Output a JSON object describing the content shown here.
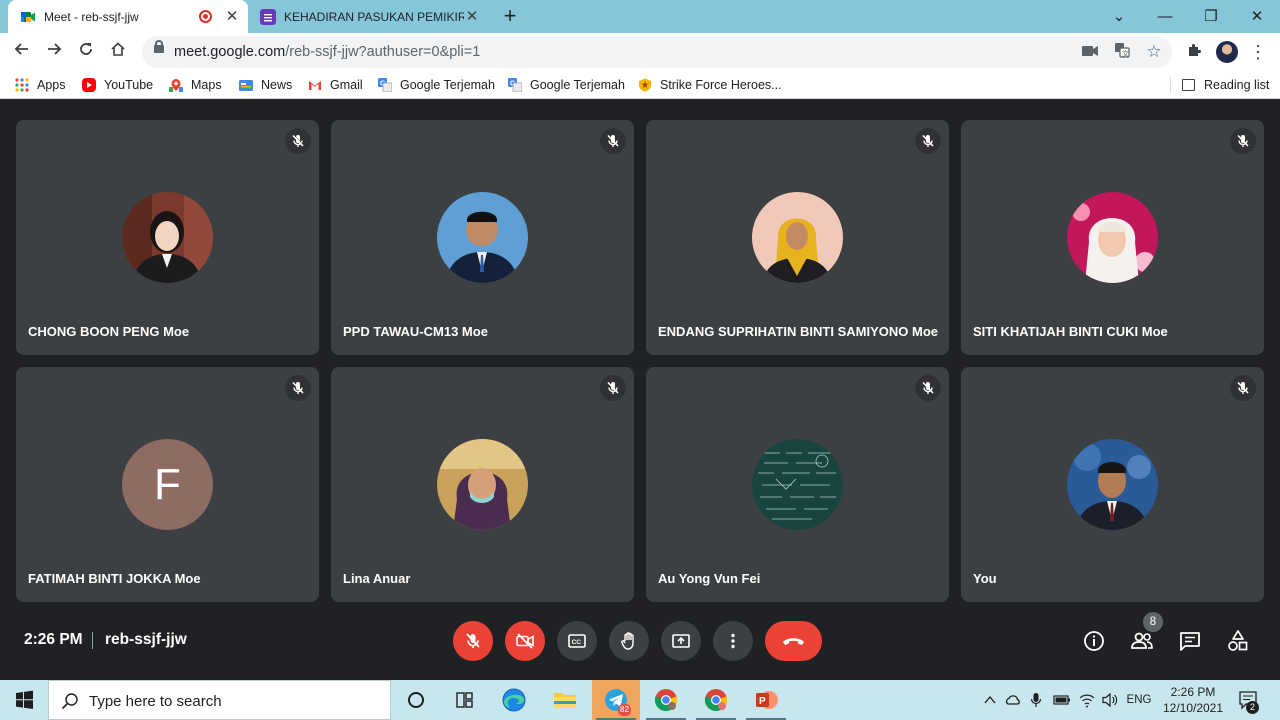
{
  "browser": {
    "tabs": [
      {
        "title": "Meet - reb-ssjf-jjw",
        "active": true
      },
      {
        "title": "KEHADIRAN PASUKAN PEMIKIR S",
        "active": false
      }
    ],
    "url_host": "meet.google.com",
    "url_path": "/reb-ssjf-jjw?authuser=0&pli=1"
  },
  "bookmarks": {
    "items": [
      {
        "label": "Apps",
        "icon": "apps-grid-icon"
      },
      {
        "label": "YouTube",
        "icon": "youtube-icon"
      },
      {
        "label": "Maps",
        "icon": "maps-icon"
      },
      {
        "label": "News",
        "icon": "news-icon"
      },
      {
        "label": "Gmail",
        "icon": "gmail-icon"
      },
      {
        "label": "Google Terjemah",
        "icon": "translate-icon"
      },
      {
        "label": "Google Terjemah",
        "icon": "translate-icon"
      },
      {
        "label": "Strike Force Heroes...",
        "icon": "shield-icon"
      }
    ],
    "reading_list": "Reading list"
  },
  "participants": [
    {
      "name": "CHONG BOON PENG Moe",
      "muted": true
    },
    {
      "name": "PPD TAWAU-CM13 Moe",
      "muted": true
    },
    {
      "name": "ENDANG SUPRIHATIN BINTI SAMIYONO Moe",
      "muted": true
    },
    {
      "name": "SITI KHATIJAH BINTI CUKI Moe",
      "muted": true
    },
    {
      "name": "FATIMAH BINTI JOKKA Moe",
      "muted": true,
      "initial": "F"
    },
    {
      "name": "Lina Anuar",
      "muted": true
    },
    {
      "name": "Au Yong Vun Fei",
      "muted": true
    },
    {
      "name": "You",
      "muted": true
    }
  ],
  "meeting": {
    "time": "2:26 PM",
    "code": "reb-ssjf-jjw",
    "participant_count": "8"
  },
  "taskbar": {
    "search_placeholder": "Type here to search",
    "telegram_badge": "82",
    "language": "ENG",
    "time": "2:26 PM",
    "date": "12/10/2021",
    "notifications": "2"
  },
  "colors": {
    "tab_strip": "#86c6d9",
    "meet_bg": "#202124",
    "tile_bg": "#3c4043",
    "red_button": "#ea4335",
    "taskbar": "#c8e6ee"
  }
}
